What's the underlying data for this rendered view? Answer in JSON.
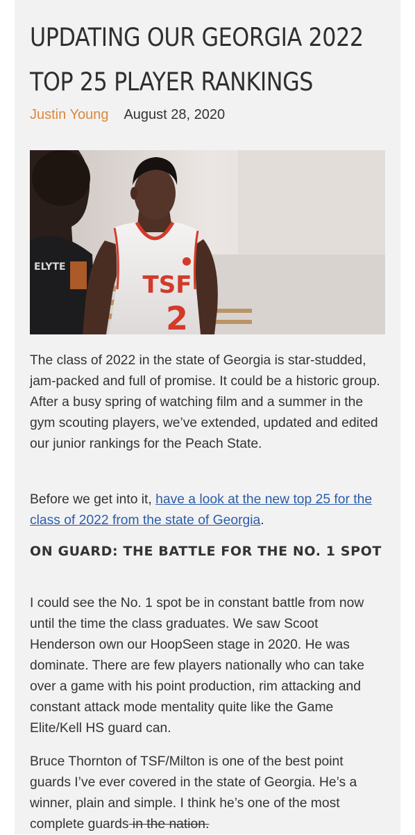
{
  "article": {
    "title_line1": "UPDATING OUR GEORGIA 2022",
    "title_line2": "TOP 25 PLAYER RANKINGS",
    "author": "Justin Young",
    "date": "August 28, 2020",
    "hero_image": {
      "jersey_text": "TSF",
      "jersey_number": "2",
      "background_player_jersey_text": "ELYTE"
    },
    "paragraph1": "The class of 2022 in the state of Georgia is star-studded, jam-packed and full of promise. It could be a historic group. After a busy spring of watching film and a summer in the gym scouting players, we’ve extended, updated and edited our junior rankings for the Peach State.",
    "paragraph2_prefix": "Before we get into it, ",
    "paragraph2_link": "have a look at the new top 25 for the class of 2022 from the state of Georgia",
    "paragraph2_suffix": ".",
    "section_heading": "ON GUARD: THE BATTLE FOR THE NO. 1 SPOT",
    "paragraph3": "I could see the No. 1 spot be in constant battle from now until the time the class graduates. We saw Scoot Henderson own our HoopSeen stage in 2020. He was dominate. There are few players nationally who can take over a game with his point production, rim attacking and constant attack mode mentality quite like the Game Elite/Kell HS guard can.",
    "paragraph4_main": "Bruce Thornton of TSF/Milton is one of the best point guards I’ve ever covered in the state of Georgia. He’s a winner, plain and simple. I think he’s one of the most complete guards",
    "paragraph4_struck": " in the nation."
  },
  "colors": {
    "author": "#d9883a",
    "link": "#2a5da8",
    "text": "#333333",
    "card_background": "#f3f2f3",
    "jersey_red": "#d23a2a"
  }
}
